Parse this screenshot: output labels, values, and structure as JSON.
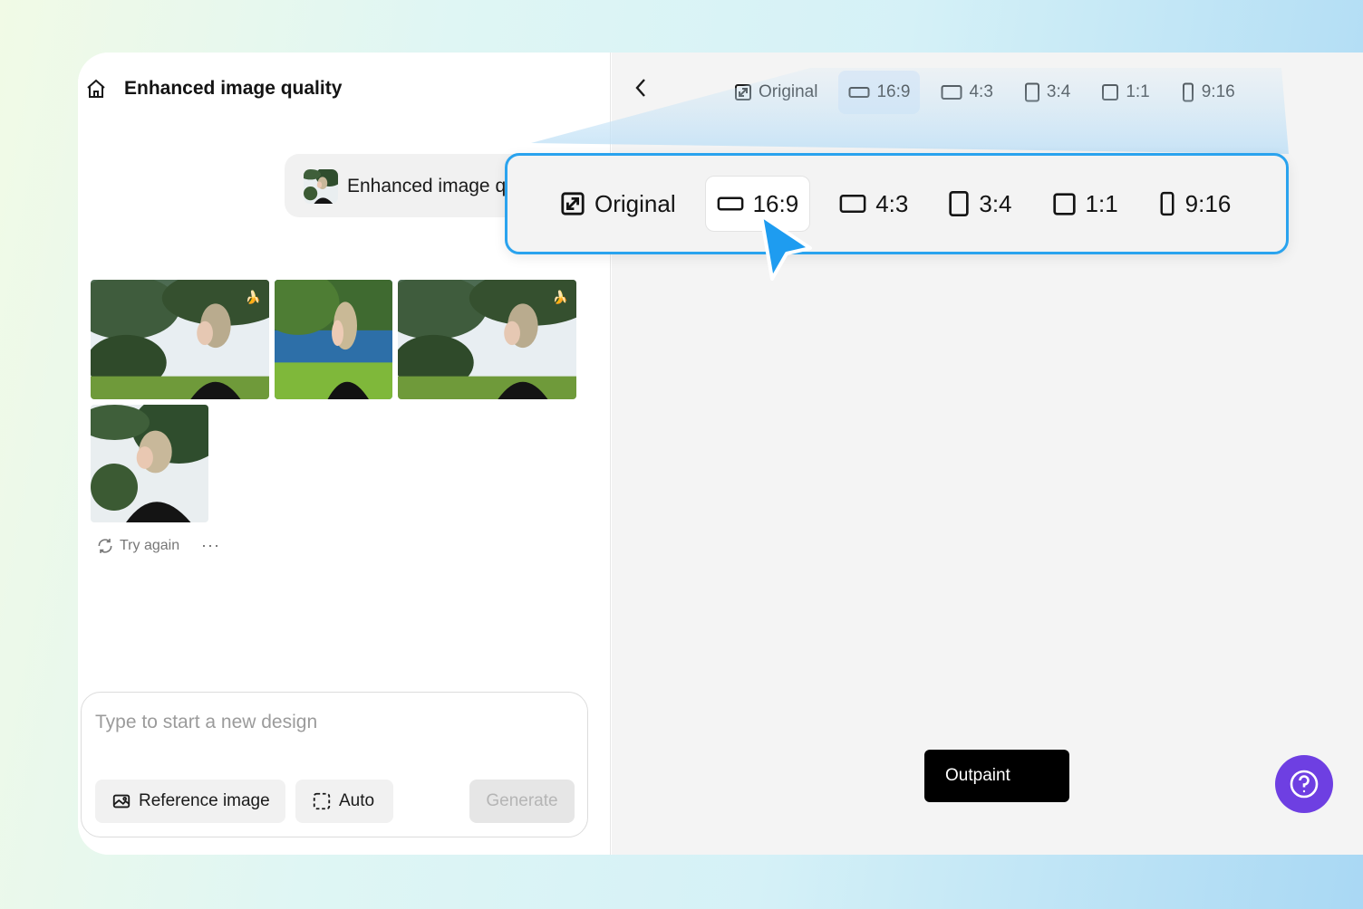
{
  "header": {
    "title": "Enhanced image quality"
  },
  "prompt": {
    "text": "Enhanced image quality"
  },
  "results": {
    "try_again_label": "Try again",
    "more_label": "···"
  },
  "composer": {
    "placeholder": "Type to start a new design",
    "reference_label": "Reference image",
    "auto_label": "Auto",
    "generate_label": "Generate"
  },
  "ratios": [
    {
      "label": "Original",
      "icon": "expand-icon"
    },
    {
      "label": "16:9",
      "icon": "wide-rect-icon",
      "selected": true
    },
    {
      "label": "4:3",
      "icon": "rect-icon"
    },
    {
      "label": "3:4",
      "icon": "portrait-rect-icon"
    },
    {
      "label": "1:1",
      "icon": "square-icon"
    },
    {
      "label": "9:16",
      "icon": "tall-rect-icon"
    }
  ],
  "canvas": {
    "outpaint_label": "Outpaint"
  },
  "colors": {
    "accent_blue": "#2aa3ee",
    "purple": "#6e3fe2",
    "frame_purple": "#6b45e6"
  }
}
